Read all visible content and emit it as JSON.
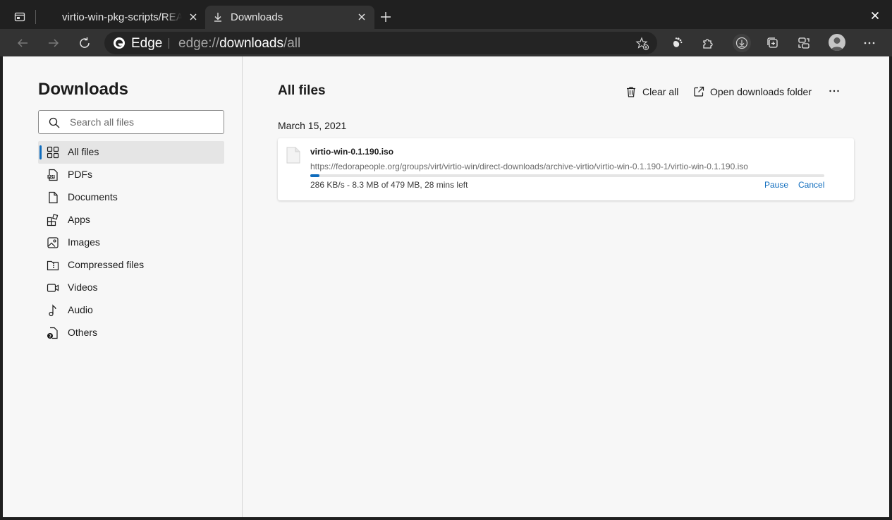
{
  "tabs": [
    {
      "title": "virtio-win-pkg-scripts/README.md at master · virtio-win/virtio-win-pkg-scripts · GitHub",
      "active": false
    },
    {
      "title": "Downloads",
      "active": true
    }
  ],
  "toolbar": {
    "brand_label": "Edge",
    "url_scheme": "edge://",
    "url_host": "downloads",
    "url_path": "/all"
  },
  "sidebar": {
    "title": "Downloads",
    "search_placeholder": "Search all files",
    "items": [
      {
        "label": "All files",
        "icon": "grid-icon",
        "selected": true
      },
      {
        "label": "PDFs",
        "icon": "pdf-icon",
        "selected": false
      },
      {
        "label": "Documents",
        "icon": "document-icon",
        "selected": false
      },
      {
        "label": "Apps",
        "icon": "apps-icon",
        "selected": false
      },
      {
        "label": "Images",
        "icon": "image-icon",
        "selected": false
      },
      {
        "label": "Compressed files",
        "icon": "archive-icon",
        "selected": false
      },
      {
        "label": "Videos",
        "icon": "video-icon",
        "selected": false
      },
      {
        "label": "Audio",
        "icon": "audio-icon",
        "selected": false
      },
      {
        "label": "Others",
        "icon": "others-icon",
        "selected": false
      }
    ]
  },
  "main": {
    "title": "All files",
    "clear_all_label": "Clear all",
    "open_folder_label": "Open downloads folder",
    "date_heading": "March 15, 2021",
    "download": {
      "file_name": "virtio-win-0.1.190.iso",
      "url": "https://fedorapeople.org/groups/virt/virtio-win/direct-downloads/archive-virtio/virtio-win-0.1.190-1/virtio-win-0.1.190.iso",
      "status": "286 KB/s - 8.3 MB of 479 MB, 28 mins left",
      "progress_fraction": 0.0173,
      "pause_label": "Pause",
      "cancel_label": "Cancel"
    }
  },
  "colors": {
    "accent": "#0f6cbd",
    "titlebar": "#202020",
    "toolbar": "#333333",
    "page_bg": "#f7f7f7"
  }
}
